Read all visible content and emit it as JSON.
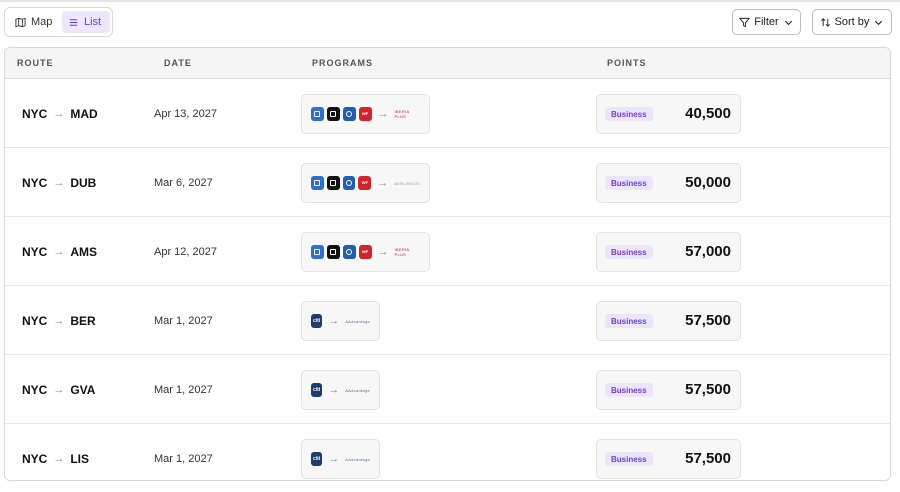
{
  "view_toggle": {
    "map_label": "Map",
    "list_label": "List",
    "active": "List"
  },
  "toolbar": {
    "filter_label": "Filter",
    "sort_label": "Sort by"
  },
  "table": {
    "columns": [
      "ROUTE",
      "DATE",
      "PROGRAMS",
      "POINTS"
    ],
    "rows": [
      {
        "origin": "NYC",
        "destination": "MAD",
        "date": "Apr 13, 2027",
        "cards": [
          "amex",
          "bilt",
          "chase",
          "wells-fargo"
        ],
        "airline": "iberia",
        "cabin": "Business",
        "points": "40,500"
      },
      {
        "origin": "NYC",
        "destination": "DUB",
        "date": "Mar 6, 2027",
        "cards": [
          "amex",
          "bilt",
          "chase",
          "wells-fargo"
        ],
        "airline": "aer-lingus",
        "cabin": "Business",
        "points": "50,000"
      },
      {
        "origin": "NYC",
        "destination": "AMS",
        "date": "Apr 12, 2027",
        "cards": [
          "amex",
          "bilt",
          "chase",
          "wells-fargo"
        ],
        "airline": "iberia",
        "cabin": "Business",
        "points": "57,000"
      },
      {
        "origin": "NYC",
        "destination": "BER",
        "date": "Mar 1, 2027",
        "cards": [
          "citi"
        ],
        "airline": "american-airlines",
        "cabin": "Business",
        "points": "57,500"
      },
      {
        "origin": "NYC",
        "destination": "GVA",
        "date": "Mar 1, 2027",
        "cards": [
          "citi"
        ],
        "airline": "american-airlines",
        "cabin": "Business",
        "points": "57,500"
      },
      {
        "origin": "NYC",
        "destination": "LIS",
        "date": "Mar 1, 2027",
        "cards": [
          "citi"
        ],
        "airline": "american-airlines",
        "cabin": "Business",
        "points": "57,500"
      }
    ]
  },
  "colors": {
    "accent": "#6d3fe0",
    "accent_bg": "#ece6fb",
    "amex": "#2e6fd1",
    "chase": "#1f5fb5",
    "wells_fargo": "#d2232a",
    "citi": "#1d3d6e"
  }
}
